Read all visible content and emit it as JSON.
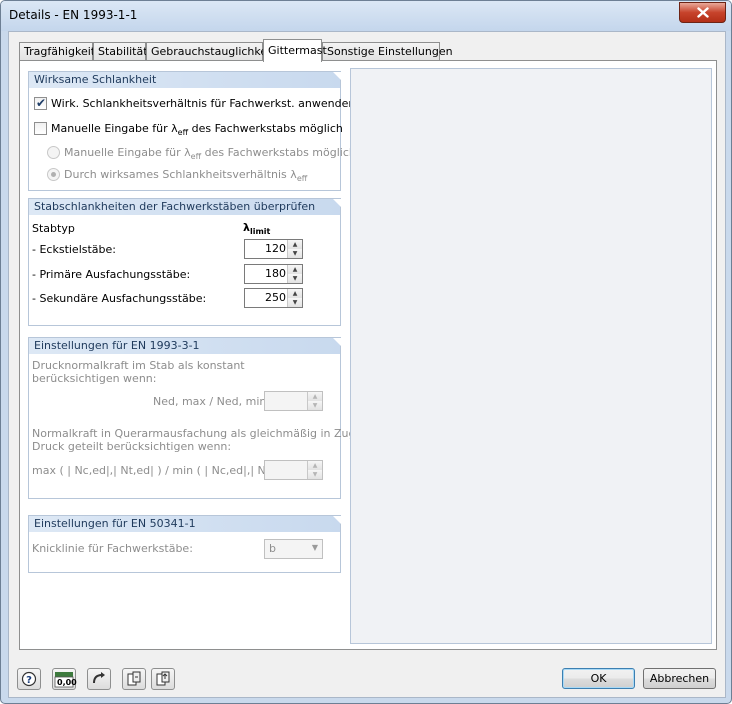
{
  "window": {
    "title": "Details - EN 1993-1-1"
  },
  "tabs": [
    {
      "label": "Tragfähigkeit"
    },
    {
      "label": "Stabilität"
    },
    {
      "label": "Gebrauchstauglichkeit"
    },
    {
      "label": "Gittermast"
    },
    {
      "label": "Sonstige Einstellungen"
    }
  ],
  "active_tab": "Gittermast",
  "group1": {
    "title": "Wirksame Schlankheit",
    "cb1": {
      "label": "Wirk. Schlankheitsverhältnis für Fachwerkst. anwenden",
      "checked": true
    },
    "cb2": {
      "label_pre": "Manuelle Eingabe für ",
      "label_sym": "λ",
      "label_sub": "eff",
      "label_post": " des Fachwerkstabs möglich",
      "checked": false
    },
    "radio1": {
      "label_pre": "Manuelle Eingabe für ",
      "label_sym": "λ",
      "label_sub": "eff",
      "label_post": " des Fachwerkstabs möglich"
    },
    "radio2": {
      "label_pre": "Durch wirksames Schlankheitsverhältnis ",
      "label_sym": "λ",
      "label_sub": "eff"
    }
  },
  "group2": {
    "title": "Stabschlankheiten der Fachwerkstäben überprüfen",
    "col_type": "Stabtyp",
    "col_limit_sym": "λ",
    "col_limit_sub": "limit",
    "rows": [
      {
        "label": "- Eckstielstäbe:",
        "value": "120"
      },
      {
        "label": "- Primäre Ausfachungsstäbe:",
        "value": "180"
      },
      {
        "label": "- Sekundäre Ausfachungsstäbe:",
        "value": "250"
      }
    ]
  },
  "group3": {
    "title": "Einstellungen für EN 1993-3-1",
    "text1_line1": "Drucknormalkraft im Stab als konstant",
    "text1_line2": "berücksichtigen wenn:",
    "ratio1": "Ned, max / Ned, min <",
    "text2_line1": "Normalkraft in Querarmausfachung als gleichmäßig in Zug und",
    "text2_line2": "Druck geteilt berücksichtigen wenn:",
    "ratio2": "max ( | Nc,ed|,| Nt,ed| ) / min ( | Nc,ed|,| Nt,ed| ) <",
    "value1": "",
    "value2": ""
  },
  "group4": {
    "title": "Einstellungen für EN 50341-1",
    "label": "Knicklinie für Fachwerkstäbe:",
    "value": "b"
  },
  "buttons": {
    "ok": "OK",
    "cancel": "Abbrechen",
    "calc_label": "0,00"
  }
}
